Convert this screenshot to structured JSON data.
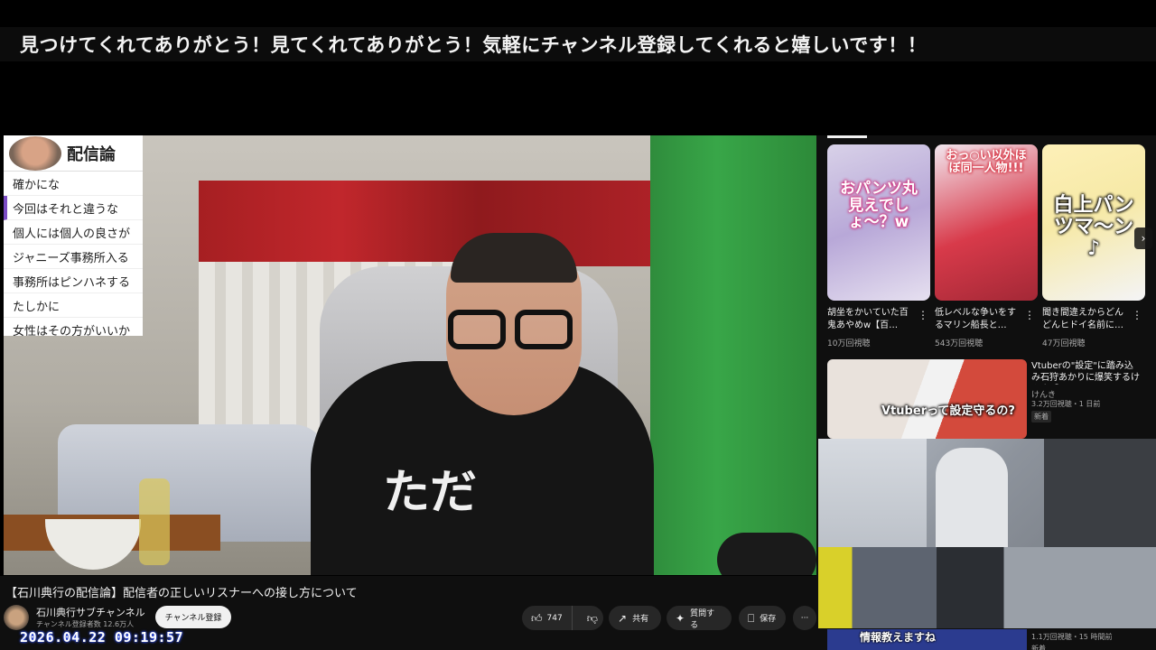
{
  "banner": {
    "text": "見つけてくれてありがとう！見てくれてありがとう！気軽にチャンネル登録してくれると嬉しいです！！"
  },
  "chat": {
    "title": "配信論",
    "messages": [
      "確かにな",
      "今回はそれと違うな",
      "個人には個人の良さが",
      "ジャニーズ事務所入る",
      "事務所はピンハネする",
      "たしかに",
      "女性はその方がいいか"
    ]
  },
  "overlay": {
    "shirt_text": "ただ"
  },
  "video": {
    "title": "【石川典行の配信論】配信者の正しいリスナーへの接し方について",
    "channel_name": "石川典行サブチャンネル",
    "subscribers": "チャンネル登録者数 12.6万人",
    "subscribe_label": "チャンネル登録",
    "like_count": "747",
    "share_label": "共有",
    "ask_label": "質問する",
    "save_label": "保存",
    "more_label": "···",
    "timestamp": "2026.04.22 09:19:57"
  },
  "shorts": [
    {
      "overlay": "おパンツ丸見えでしょ〜？w",
      "title": "胡坐をかいていた百鬼あやめw【百…",
      "views": "10万回視聴"
    },
    {
      "overlay": "おっ○い以外ほぼ同一人物!!!",
      "title": "低レベルな争いをするマリン船長と…",
      "views": "543万回視聴"
    },
    {
      "overlay": "白上パンツマ〜ン♪",
      "title": "聞き間違えからどんどんヒドイ名前に…",
      "views": "47万回視聴"
    }
  ],
  "recommended": {
    "thumb_text": "Vtuberって設定守るの?",
    "title": "Vtuberの\"設定\"に踏み込み石狩あかりに爆笑するけんき【メ…",
    "channel": "けんき",
    "meta": "3.2万回視聴・1 日前",
    "badge": "新着"
  },
  "bottom_item": {
    "thumb_text": "情報教えますね",
    "meta": "1.1万回視聴・15 時間前",
    "badge": "新着"
  },
  "icons": {
    "like": "thumbs-up-icon",
    "dislike": "thumbs-down-icon",
    "share": "share-icon",
    "ask": "sparkle-icon",
    "save": "bookmark-icon",
    "more": "more-horizontal-icon",
    "next": "chevron-right-icon"
  }
}
